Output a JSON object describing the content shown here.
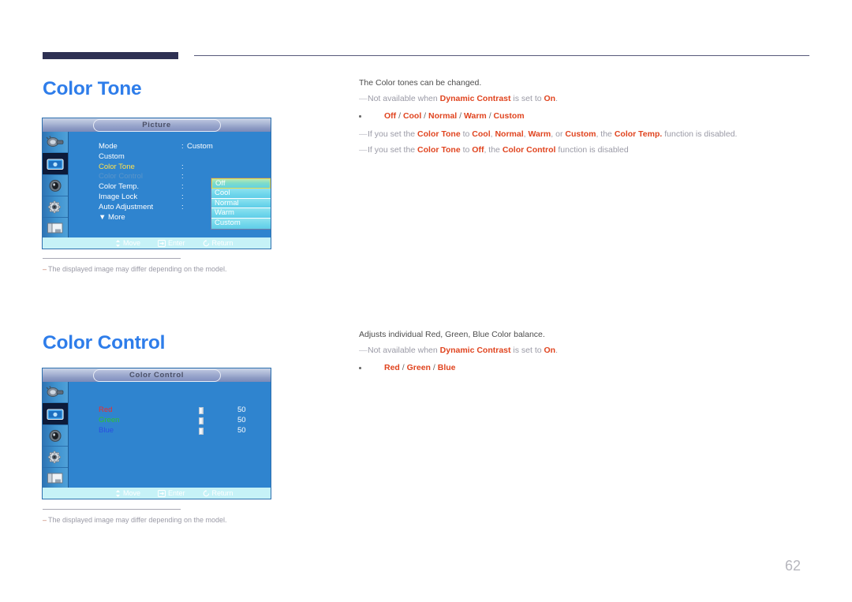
{
  "page": {
    "number": "62"
  },
  "sections": [
    {
      "title": "Color Tone",
      "lead": "The Color tones can be changed.",
      "notes_before": [
        {
          "text_parts": [
            {
              "t": "Not available when ",
              "style": "gray"
            },
            {
              "t": "Dynamic Contrast",
              "style": "bold"
            },
            {
              "t": " is set to ",
              "style": "gray"
            },
            {
              "t": "On",
              "style": "bold"
            },
            {
              "t": ".",
              "style": "gray"
            }
          ]
        }
      ],
      "bullet_options": [
        "Off",
        "Cool",
        "Normal",
        "Warm",
        "Custom"
      ],
      "notes_after": [
        {
          "text_parts": [
            {
              "t": "If you set the ",
              "style": "gray"
            },
            {
              "t": "Color Tone",
              "style": "bold"
            },
            {
              "t": " to ",
              "style": "gray"
            },
            {
              "t": "Cool",
              "style": "bold"
            },
            {
              "t": ", ",
              "style": "gray"
            },
            {
              "t": "Normal",
              "style": "bold"
            },
            {
              "t": ", ",
              "style": "gray"
            },
            {
              "t": "Warm",
              "style": "bold"
            },
            {
              "t": ", or ",
              "style": "gray"
            },
            {
              "t": "Custom",
              "style": "bold"
            },
            {
              "t": ", the ",
              "style": "gray"
            },
            {
              "t": "Color Temp.",
              "style": "bold"
            },
            {
              "t": " function is disabled.",
              "style": "gray"
            }
          ]
        },
        {
          "text_parts": [
            {
              "t": "If you set the ",
              "style": "gray"
            },
            {
              "t": "Color Tone",
              "style": "bold"
            },
            {
              "t": " to ",
              "style": "gray"
            },
            {
              "t": "Off",
              "style": "bold"
            },
            {
              "t": ", the ",
              "style": "gray"
            },
            {
              "t": "Color Control",
              "style": "bold"
            },
            {
              "t": " function is disabled",
              "style": "gray"
            }
          ]
        }
      ],
      "figure_note": "The displayed image may differ depending on the model."
    },
    {
      "title": "Color Control",
      "lead": "Adjusts individual Red, Green, Blue Color balance.",
      "notes_before": [
        {
          "text_parts": [
            {
              "t": "Not available when ",
              "style": "gray"
            },
            {
              "t": "Dynamic Contrast",
              "style": "bold"
            },
            {
              "t": " is set to ",
              "style": "gray"
            },
            {
              "t": "On",
              "style": "bold"
            },
            {
              "t": ".",
              "style": "gray"
            }
          ]
        }
      ],
      "bullet_options": [
        "Red",
        "Green",
        "Blue"
      ],
      "notes_after": [],
      "figure_note": "The displayed image may differ depending on the model."
    }
  ],
  "osd_picture": {
    "title": "Picture",
    "sidebar_icons": [
      "input-source-icon",
      "picture-icon",
      "sound-icon",
      "setup-gear-icon",
      "multi-control-icon"
    ],
    "rows": [
      {
        "label": "Mode",
        "colon": ":",
        "value": "Custom",
        "state": "normal"
      },
      {
        "label": "Custom",
        "colon": "",
        "value": "",
        "state": "normal"
      },
      {
        "label": "Color Tone",
        "colon": ":",
        "value": "",
        "state": "selected"
      },
      {
        "label": "Color Control",
        "colon": ":",
        "value": "",
        "state": "disabled"
      },
      {
        "label": "Color Temp.",
        "colon": ":",
        "value": "",
        "state": "normal"
      },
      {
        "label": "Image Lock",
        "colon": ":",
        "value": "",
        "state": "normal"
      },
      {
        "label": "Auto Adjustment",
        "colon": ":",
        "value": "",
        "state": "normal"
      },
      {
        "label": "▼ More",
        "colon": "",
        "value": "",
        "state": "more"
      }
    ],
    "dropdown": {
      "items": [
        "Off",
        "Cool",
        "Normal",
        "Warm",
        "Custom"
      ],
      "selected": "Off"
    },
    "footer": [
      {
        "icon": "updown-arrow-icon",
        "label": "Move"
      },
      {
        "icon": "enter-icon",
        "label": "Enter"
      },
      {
        "icon": "return-icon",
        "label": "Return"
      }
    ]
  },
  "osd_colorcontrol": {
    "title": "Color Control",
    "sidebar_icons": [
      "input-source-icon",
      "picture-icon",
      "sound-icon",
      "setup-gear-icon",
      "multi-control-icon"
    ],
    "rows": [
      {
        "name": "Red",
        "value": "50",
        "color": "#ee2b2b"
      },
      {
        "name": "Green",
        "value": "50",
        "color": "#2fc22f"
      },
      {
        "name": "Blue",
        "value": "50",
        "color": "#2a4fe0"
      }
    ],
    "footer": [
      {
        "icon": "updown-arrow-icon",
        "label": "Move"
      },
      {
        "icon": "enter-icon",
        "label": "Enter"
      },
      {
        "icon": "return-icon",
        "label": "Return"
      }
    ]
  },
  "colors": {
    "heading_blue": "#2e7dea",
    "rule_navy": "#2e3153",
    "accent_red": "#e0441f",
    "osd_blue": "#2f84cf",
    "osd_footer": "#c6f2f7",
    "selected_yellow": "#ffe14d"
  }
}
